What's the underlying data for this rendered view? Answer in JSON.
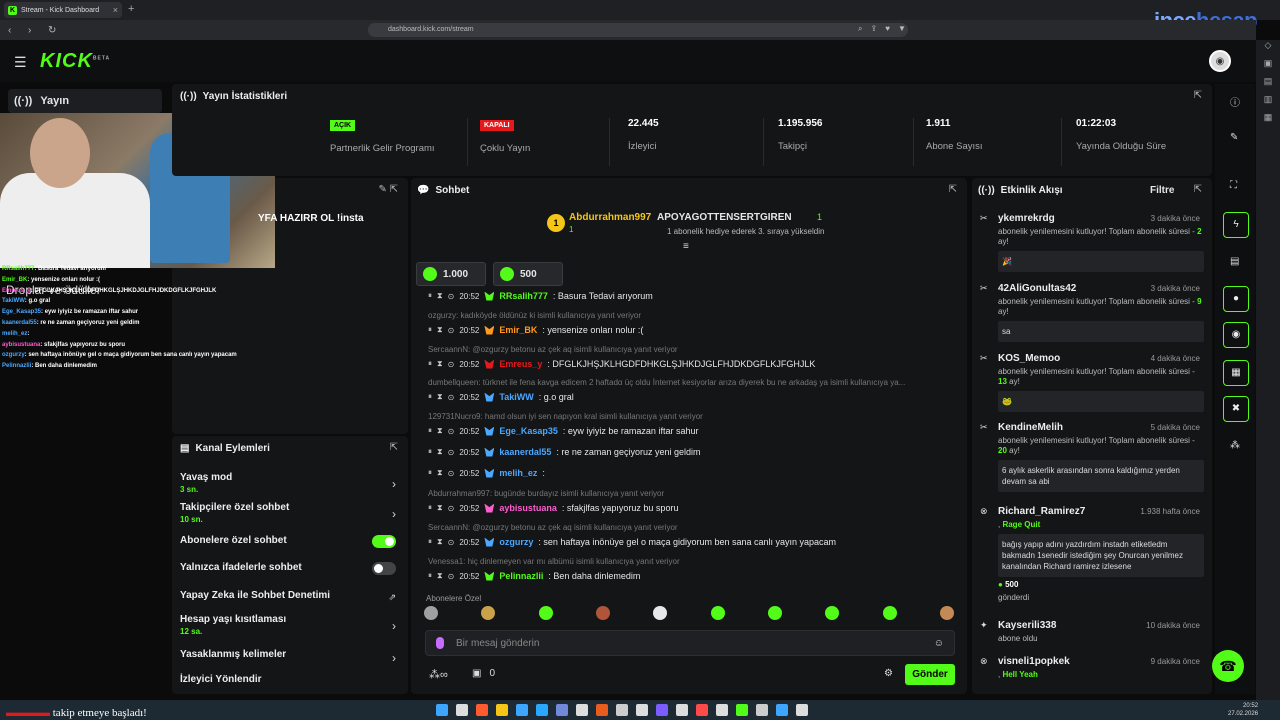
{
  "browser": {
    "tab_title": "Stream - Kick Dashboard",
    "url": "dashboard.kick.com/stream"
  },
  "watermark": {
    "part1": "ince",
    "part2": "hesap"
  },
  "logo": {
    "text": "KICK",
    "sup": "BETA"
  },
  "nav": {
    "stream_label": "Yayın"
  },
  "camera_overlay_text": "YFA HAZIRR OL !insta",
  "left_overlay": {
    "title": "Droplar ve ödüller",
    "lines": [
      {
        "user": "RRsalih777",
        "text": ": Basura Tedavi arıyorum",
        "color": "n"
      },
      {
        "user": "Emir_BK",
        "text": ": yensenize onları nolur :(",
        "color": "n"
      },
      {
        "user": "Emreus_y",
        "text": ": DFGLKJHŞJKLHGDFDHKGLŞJHKDJGLFHJDKDGFLKJFGHJLK",
        "color": "p"
      },
      {
        "user": "TakiWW",
        "text": ": g.o gral",
        "color": "b"
      },
      {
        "user": "Ege_Kasap35",
        "text": ": eyw iyiyiz be ramazan iftar sahur",
        "color": "b"
      },
      {
        "user": "kaanerdal55",
        "text": ": re ne zaman geçiyoruz yeni geldim",
        "color": "b"
      },
      {
        "user": "melih_ez",
        "text": ":",
        "color": "b"
      },
      {
        "user": "aybisustuana",
        "text": ": sfakjlfas yapıyoruz bu sporu",
        "color": "p"
      },
      {
        "user": "ozgurzy",
        "text": ": sen haftaya inönüye gel o maça gidiyorum ben sana canlı yayın yapacam",
        "color": "b"
      },
      {
        "user": "Pelinnazlii",
        "text": ": Ben daha dinlemedim",
        "color": "b"
      }
    ]
  },
  "stats": {
    "title": "Yayın İstatistikleri",
    "items": [
      {
        "badge": "AÇIK",
        "badge_color": "#53fc18",
        "label": "Partnerlik Gelir Programı"
      },
      {
        "badge": "KAPALI",
        "badge_color": "#e5191c",
        "label": "Çoklu Yayın"
      },
      {
        "value": "22.445",
        "label": "İzleyici"
      },
      {
        "value": "1.195.956",
        "label": "Takipçi"
      },
      {
        "value": "1.911",
        "label": "Abone Sayısı"
      },
      {
        "value": "01:22:03",
        "label": "Yayında Olduğu Süre"
      }
    ]
  },
  "actions": {
    "title": "Kanal Eylemleri",
    "slow_mode": {
      "label": "Yavaş mod",
      "sub": "3 sn."
    },
    "followers_only": {
      "label": "Takipçilere özel sohbet",
      "sub": "10 sn."
    },
    "subs_only": {
      "label": "Abonelere özel sohbet",
      "on": true
    },
    "emotes_only": {
      "label": "Yalnızca ifadelerle sohbet",
      "on": false
    },
    "ai_mod": {
      "label": "Yapay Zeka ile Sohbet Denetimi"
    },
    "age": {
      "label": "Hesap yaşı kısıtlaması",
      "sub": "12 sa."
    },
    "banned_words": {
      "label": "Yasaklanmış kelimeler"
    },
    "raid": {
      "label": "İzleyici Yönlendir"
    }
  },
  "chat": {
    "title": "Sohbet",
    "pinned": {
      "rank": "1",
      "user": "Abdurrahman997",
      "count": "1",
      "target": "APOYAGOTTENSERTGIREN",
      "target_count": "1",
      "text": "1 abonelik hediye ederek 3. sıraya yükseldin"
    },
    "gifts": [
      {
        "value": "1.000"
      },
      {
        "value": "500"
      }
    ],
    "messages": [
      {
        "reply": "",
        "time": "20:52",
        "user": "RRsalih777",
        "color": "#53fc18",
        "text": ": Basura Tedavi arıyorum"
      },
      {
        "reply": "ozgurzy: kadıköyde öldünüz ki isimli kullanıcıya yanıt veriyor",
        "time": "20:52",
        "user": "Emir_BK",
        "color": "#ff9a1e",
        "text": ": yensenize onları nolur :("
      },
      {
        "reply": "SercaannN: @ozgurzy betonu az çek aq isimli kullanıcıya yanıt veriyor",
        "time": "20:52",
        "user": "Emreus_y",
        "color": "#e5191c",
        "text": ": DFGLKJHŞJKLHGDFDHKGLŞJHKDJGLFHJDKDGFLKJFGHJLK"
      },
      {
        "reply": "dumbellqueen: türknet ile fena kavga edicem 2 haftadα üç oldu İnternet kesiyorlar arıza diyerek bu ne arkadaş ya isimli kullanıcıya ya...",
        "time": "20:52",
        "user": "TakiWW",
        "color": "#4aa8ff",
        "text": ": g.o gral"
      },
      {
        "reply": "129731Nucro9: hamd olsun iyi sen napıyon kral isimli kullanıcıya yanıt veriyor",
        "time": "20:52",
        "user": "Ege_Kasap35",
        "color": "#4aa8ff",
        "text": ": eyw iyiyiz be ramazan iftar sahur"
      },
      {
        "reply": "",
        "time": "20:52",
        "user": "kaanerdal55",
        "color": "#4aa8ff",
        "text": ": re ne zaman geçiyoruz yeni geldim"
      },
      {
        "reply": "",
        "time": "20:52",
        "user": "melih_ez",
        "color": "#4aa8ff",
        "text": ":"
      },
      {
        "reply": "Abdurrahman997: bugünde burdayız isimli kullanıcıya yanıt veriyor",
        "time": "20:52",
        "user": "aybisustuana",
        "color": "#ff5bd0",
        "text": ": sfakjlfas yapıyoruz bu sporu"
      },
      {
        "reply": "SercaannN: @ozgurzy betonu az çek aq isimli kullanıcıya yanıt veriyor",
        "time": "20:52",
        "user": "ozgurzy",
        "color": "#4aa8ff",
        "text": ": sen haftaya inönüye gel o maça gidiyorum ben sana canlı yayın yapacam"
      },
      {
        "reply": "Venessa1: hiç dinlemeyen var mı albümü isimli kullanıcıya yanıt veriyor",
        "time": "20:52",
        "user": "Pelinnazlii",
        "color": "#53fc18",
        "text": ": Ben daha dinlemedim"
      }
    ],
    "emote_section": "Abonelere Özel",
    "emote_colors": [
      "#a0a0a0",
      "#c9a24a",
      "#53fc18",
      "#b0553a",
      "#e8e8e8",
      "#53fc18",
      "#53fc18",
      "#53fc18",
      "#53fc18",
      "#c48a55"
    ],
    "placeholder": "Bir mesaj gönderin",
    "bottom_count": "0",
    "send": "Gönder"
  },
  "events": {
    "title": "Etkinlik Akışı",
    "filter": "Filtre",
    "items": [
      {
        "user": "ykemrekrdg",
        "time": "3 dakika önce",
        "desc": "abonelik yenilemesini kutluyor! Toplam abonelik süresi -",
        "num": "2",
        "suffix": "ay!",
        "box": "🎉"
      },
      {
        "user": "42AliGonultas42",
        "time": "3 dakika önce",
        "desc": "abonelik yenilemesini kutluyor! Toplam abonelik süresi -",
        "num": "9",
        "suffix": "ay!",
        "box": "sa"
      },
      {
        "user": "KOS_Memoo",
        "time": "4 dakika önce",
        "desc": "abonelik yenilemesini kutluyor! Toplam abonelik süresi -",
        "num": "13",
        "suffix": "ay!",
        "box": "🐸"
      },
      {
        "user": "KendineMelih",
        "time": "5 dakika önce",
        "desc": "abonelik yenilemesini kutluyor! Toplam abonelik süresi -",
        "num": "20",
        "suffix": "ay!",
        "box": "6 aylık askerlik arasından sonra kaldığımız yerden devam sa abi"
      },
      {
        "user": "Richard_Ramirez7",
        "time": "1.938 hafta önce",
        "sub": "Rage Quit",
        "box": "bağış yapıp adını yazdırdım instadn etiketledm bakmadn 1senedir istediğim şey Onurcan yenilmez kanalından Richard ramirez izlesene",
        "amount": "500",
        "extra": "gönderdi"
      },
      {
        "user": "Kayserili338",
        "time": "10 dakika önce",
        "desc2": "abone oldu"
      },
      {
        "user": "visneli1popkek",
        "time": "9 dakika önce",
        "sub": "Hell Yeah"
      }
    ]
  },
  "taskbar": {
    "follow_text": "takip etmeye başladı!",
    "time": "20:52",
    "date": "27.02.2026"
  }
}
